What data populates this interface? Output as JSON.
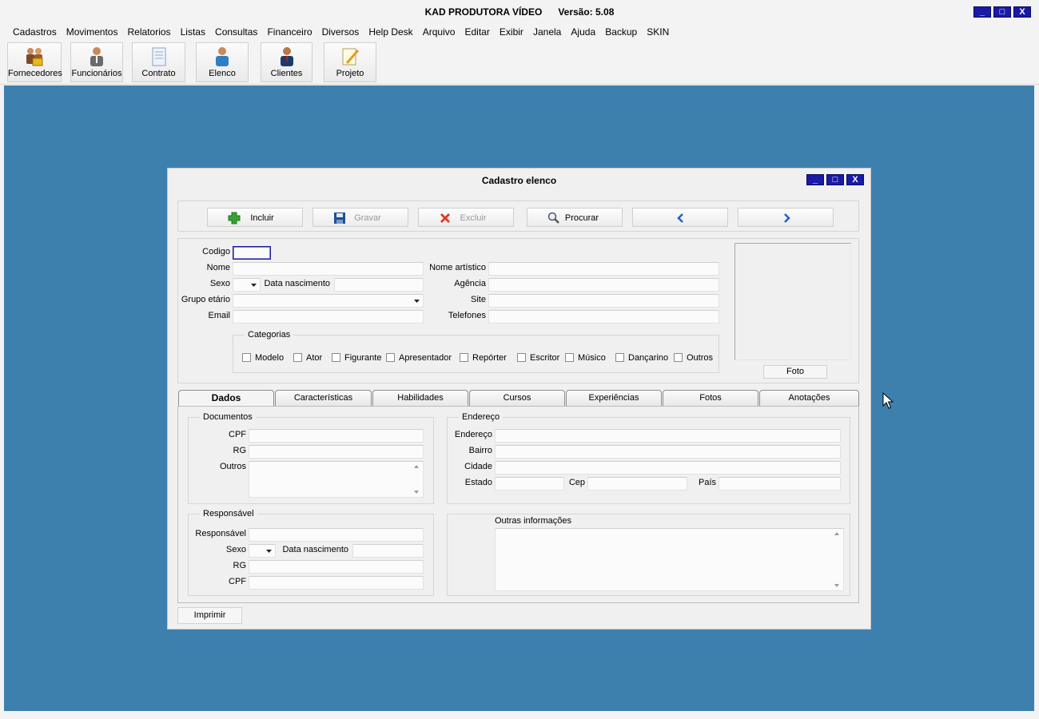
{
  "app": {
    "title": "KAD PRODUTORA VÍDEO",
    "version": "Versão: 5.08",
    "window_controls": [
      "_",
      "□",
      "X"
    ]
  },
  "menu": [
    "Cadastros",
    "Movimentos",
    "Relatorios",
    "Listas",
    "Consultas",
    "Financeiro",
    "Diversos",
    "Help Desk",
    "Arquivo",
    "Editar",
    "Exibir",
    "Janela",
    "Ajuda",
    "Backup",
    "SKIN"
  ],
  "toolbar": [
    {
      "label": "Fornecedores",
      "icon": "suppliers-icon"
    },
    {
      "label": "Funcionários",
      "icon": "employee-icon"
    },
    {
      "label": "Contrato",
      "icon": "contract-icon"
    },
    {
      "label": "Elenco",
      "icon": "cast-icon"
    },
    {
      "label": "Clientes",
      "icon": "client-icon"
    },
    {
      "label": "Projeto",
      "icon": "project-icon"
    }
  ],
  "colors": {
    "desktop": "#3d80ae",
    "title_button": "#1a1aa8",
    "add_green": "#34a234",
    "delete_red": "#e03a2a",
    "nav_blue": "#1f63c6"
  },
  "child": {
    "title": "Cadastro elenco",
    "actions": {
      "add": "Incluir",
      "save": "Gravar",
      "delete": "Excluir",
      "search": "Procurar"
    },
    "fields": {
      "codigo": "Codigo",
      "nome": "Nome",
      "sexo": "Sexo",
      "data_nascimento": "Data nascimento",
      "grupo_etario": "Grupo etário",
      "email": "Email",
      "nome_artistico": "Nome artístico",
      "agencia": "Agência",
      "site": "Site",
      "telefones": "Telefones"
    },
    "categorias": {
      "title": "Categorias",
      "items": [
        "Modelo",
        "Ator",
        "Figurante",
        "Apresentador",
        "Repórter",
        "Escritor",
        "Músico",
        "Dançarino",
        "Outros"
      ]
    },
    "foto_button": "Foto",
    "tabs": [
      "Dados",
      "Características",
      "Habilidades",
      "Cursos",
      "Experiências",
      "Fotos",
      "Anotações"
    ],
    "active_tab": "Dados",
    "documentos": {
      "title": "Documentos",
      "cpf": "CPF",
      "rg": "RG",
      "outros": "Outros"
    },
    "endereco": {
      "title": "Endereço",
      "endereco": "Endereço",
      "bairro": "Bairro",
      "cidade": "Cidade",
      "estado": "Estado",
      "cep": "Cep",
      "pais": "País"
    },
    "responsavel": {
      "title": "Responsável",
      "responsavel": "Responsável",
      "sexo": "Sexo",
      "data_nascimento": "Data nascimento",
      "rg": "RG",
      "cpf": "CPF"
    },
    "outras_informacoes": "Outras informações",
    "print_button": "Imprimir"
  }
}
